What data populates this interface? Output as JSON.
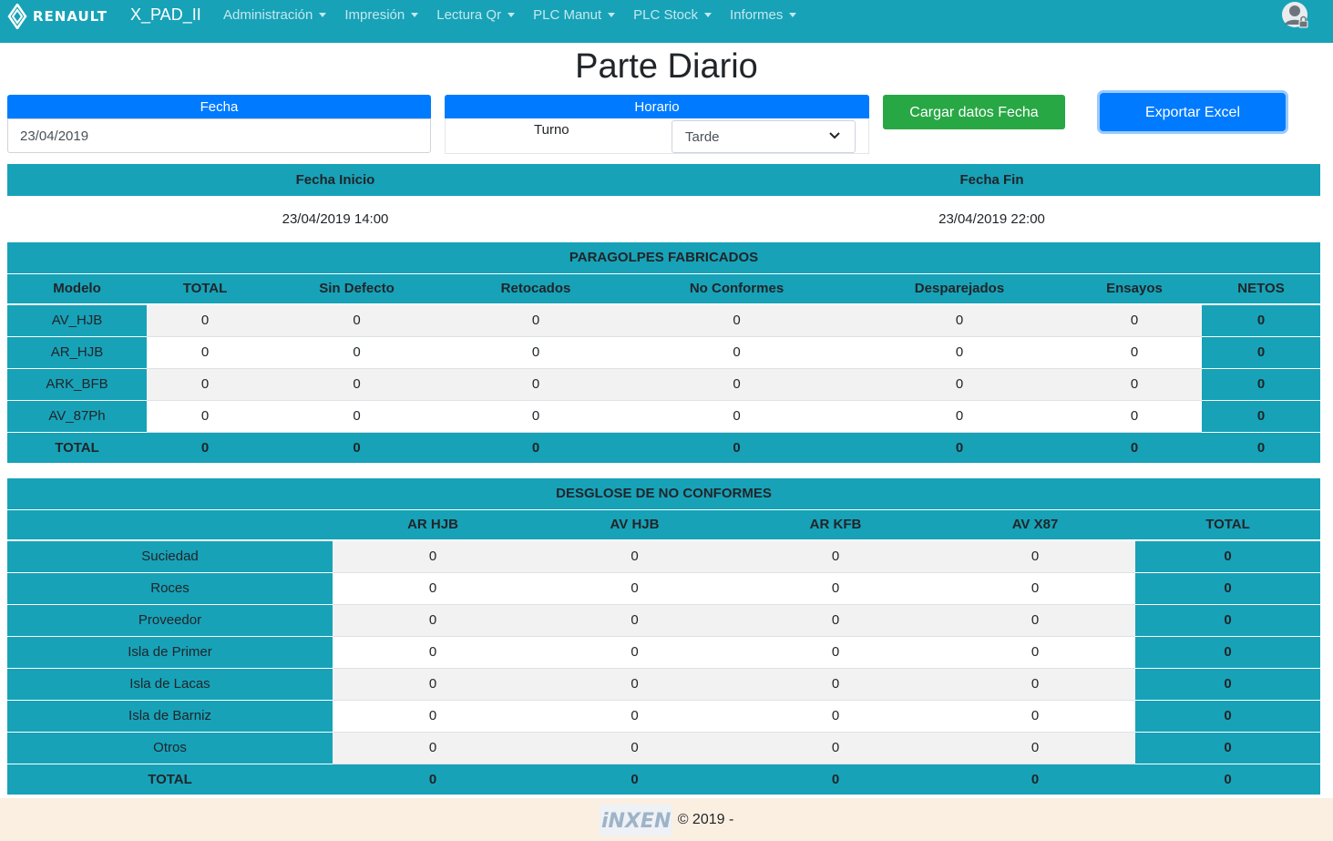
{
  "navbar": {
    "brand": "RENAULT",
    "app_name": "X_PAD_II",
    "menu": [
      "Administración",
      "Impresión",
      "Lectura Qr",
      "PLC Manut",
      "PLC Stock",
      "Informes"
    ],
    "user_icon": "user-lock-icon"
  },
  "page": {
    "title": "Parte Diario"
  },
  "form": {
    "fecha_label": "Fecha",
    "fecha_value": "23/04/2019",
    "horario_label": "Horario",
    "turno_label": "Turno",
    "turno_value": "Tarde",
    "load_button": "Cargar datos Fecha",
    "export_button": "Exportar Excel"
  },
  "range": {
    "start_label": "Fecha Inicio",
    "end_label": "Fecha Fin",
    "start_value": "23/04/2019 14:00",
    "end_value": "23/04/2019 22:00"
  },
  "production": {
    "caption": "PARAGOLPES FABRICADOS",
    "columns": [
      "Modelo",
      "TOTAL",
      "Sin Defecto",
      "Retocados",
      "No Conformes",
      "Desparejados",
      "Ensayos",
      "NETOS"
    ],
    "rows": [
      {
        "model": "AV_HJB",
        "values": [
          "0",
          "0",
          "0",
          "0",
          "0",
          "0"
        ],
        "net": "0"
      },
      {
        "model": "AR_HJB",
        "values": [
          "0",
          "0",
          "0",
          "0",
          "0",
          "0"
        ],
        "net": "0"
      },
      {
        "model": "ARK_BFB",
        "values": [
          "0",
          "0",
          "0",
          "0",
          "0",
          "0"
        ],
        "net": "0"
      },
      {
        "model": "AV_87Ph",
        "values": [
          "0",
          "0",
          "0",
          "0",
          "0",
          "0"
        ],
        "net": "0"
      }
    ],
    "total": {
      "label": "TOTAL",
      "values": [
        "0",
        "0",
        "0",
        "0",
        "0",
        "0"
      ],
      "net": "0"
    }
  },
  "nonconform": {
    "caption": "DESGLOSE DE NO CONFORMES",
    "columns": [
      "",
      "AR HJB",
      "AV HJB",
      "AR KFB",
      "AV X87",
      "TOTAL"
    ],
    "rows": [
      {
        "label": "Suciedad",
        "values": [
          "0",
          "0",
          "0",
          "0"
        ],
        "total": "0"
      },
      {
        "label": "Roces",
        "values": [
          "0",
          "0",
          "0",
          "0"
        ],
        "total": "0"
      },
      {
        "label": "Proveedor",
        "values": [
          "0",
          "0",
          "0",
          "0"
        ],
        "total": "0"
      },
      {
        "label": "Isla de Primer",
        "values": [
          "0",
          "0",
          "0",
          "0"
        ],
        "total": "0"
      },
      {
        "label": "Isla de Lacas",
        "values": [
          "0",
          "0",
          "0",
          "0"
        ],
        "total": "0"
      },
      {
        "label": "Isla de Barniz",
        "values": [
          "0",
          "0",
          "0",
          "0"
        ],
        "total": "0"
      },
      {
        "label": "Otros",
        "values": [
          "0",
          "0",
          "0",
          "0"
        ],
        "total": "0"
      }
    ],
    "total": {
      "label": "TOTAL",
      "values": [
        "0",
        "0",
        "0",
        "0"
      ],
      "total": "0"
    }
  },
  "footer": {
    "logo_text": "iNXEN",
    "text": "© 2019 -"
  },
  "colors": {
    "teal": "#17a2b8",
    "primary": "#007bff",
    "success": "#28a745",
    "footer_bg": "#fbefe2"
  }
}
